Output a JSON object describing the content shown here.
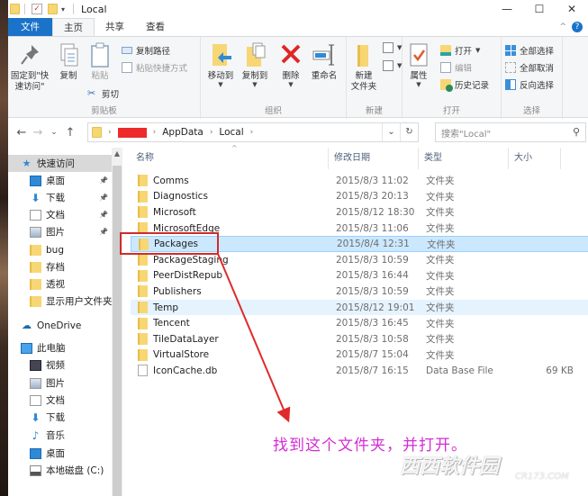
{
  "window": {
    "title": "Local",
    "controls": {
      "minimize": "—",
      "maximize": "☐",
      "close": "✕"
    }
  },
  "quick_access_toolbar": {
    "dropdown": "▾"
  },
  "tabs": [
    {
      "label": "文件",
      "type": "file"
    },
    {
      "label": "主页",
      "active": true
    },
    {
      "label": "共享"
    },
    {
      "label": "查看"
    }
  ],
  "ribbon": {
    "collapse": "^",
    "help": "?",
    "groups": {
      "clipboard": {
        "label": "剪贴板",
        "pin": "固定到\"快\n速访问\"",
        "copy": "复制",
        "paste": "粘贴",
        "copy_path": "复制路径",
        "paste_shortcut": "粘贴快捷方式",
        "cut": "剪切"
      },
      "organize": {
        "label": "组织",
        "move_to": "移动到",
        "copy_to": "复制到",
        "delete": "删除",
        "rename": "重命名"
      },
      "new": {
        "label": "新建",
        "new_folder": "新建\n文件夹"
      },
      "open": {
        "label": "打开",
        "properties": "属性",
        "open": "打开",
        "edit": "编辑",
        "history": "历史记录"
      },
      "select": {
        "label": "选择",
        "select_all": "全部选择",
        "select_none": "全部取消",
        "invert": "反向选择"
      }
    }
  },
  "navigation": {
    "back": "←",
    "forward": "→",
    "recent": "⌄",
    "up": "↑",
    "breadcrumb": [
      "AppData",
      "Local"
    ],
    "redacted_color": "#ee2b2b",
    "dropdown": "⌄",
    "refresh": "↻",
    "search_placeholder": "搜索\"Local\"",
    "search_icon": "⚲"
  },
  "sidebar": {
    "items": [
      {
        "label": "快速访问",
        "icon": "star-icon",
        "selected": true
      },
      {
        "label": "桌面",
        "icon": "desktop-icon",
        "pinned": true
      },
      {
        "label": "下载",
        "icon": "download-icon",
        "pinned": true
      },
      {
        "label": "文档",
        "icon": "document-icon",
        "pinned": true
      },
      {
        "label": "图片",
        "icon": "pictures-icon",
        "pinned": true
      },
      {
        "label": "bug",
        "icon": "folder-icon"
      },
      {
        "label": "存档",
        "icon": "folder-icon"
      },
      {
        "label": "透视",
        "icon": "folder-icon"
      },
      {
        "label": "显示用户文件夹",
        "icon": "folder-icon"
      },
      {
        "label": "OneDrive",
        "icon": "cloud-icon"
      },
      {
        "label": "此电脑",
        "icon": "computer-icon"
      },
      {
        "label": "视频",
        "icon": "video-icon"
      },
      {
        "label": "图片",
        "icon": "pictures-icon"
      },
      {
        "label": "文档",
        "icon": "document-icon"
      },
      {
        "label": "下载",
        "icon": "download-icon"
      },
      {
        "label": "音乐",
        "icon": "music-icon"
      },
      {
        "label": "桌面",
        "icon": "desktop-icon"
      },
      {
        "label": "本地磁盘 (C:)",
        "icon": "drive-icon"
      }
    ]
  },
  "file_list": {
    "columns": [
      "名称",
      "修改日期",
      "类型",
      "大小"
    ],
    "rows": [
      {
        "name": "Comms",
        "date": "2015/8/3 11:02",
        "type": "文件夹",
        "size": ""
      },
      {
        "name": "Diagnostics",
        "date": "2015/8/3 20:13",
        "type": "文件夹",
        "size": ""
      },
      {
        "name": "Microsoft",
        "date": "2015/8/12 18:30",
        "type": "文件夹",
        "size": ""
      },
      {
        "name": "MicrosoftEdge",
        "date": "2015/8/3 11:06",
        "type": "文件夹",
        "size": ""
      },
      {
        "name": "Packages",
        "date": "2015/8/4 12:31",
        "type": "文件夹",
        "size": "",
        "selected": true
      },
      {
        "name": "PackageStaging",
        "date": "2015/8/3 10:59",
        "type": "文件夹",
        "size": ""
      },
      {
        "name": "PeerDistRepub",
        "date": "2015/8/3 16:44",
        "type": "文件夹",
        "size": ""
      },
      {
        "name": "Publishers",
        "date": "2015/8/3 10:59",
        "type": "文件夹",
        "size": ""
      },
      {
        "name": "Temp",
        "date": "2015/8/12 19:01",
        "type": "文件夹",
        "size": "",
        "hover": true
      },
      {
        "name": "Tencent",
        "date": "2015/8/3 16:45",
        "type": "文件夹",
        "size": ""
      },
      {
        "name": "TileDataLayer",
        "date": "2015/8/3 10:58",
        "type": "文件夹",
        "size": ""
      },
      {
        "name": "VirtualStore",
        "date": "2015/8/7 15:04",
        "type": "文件夹",
        "size": ""
      },
      {
        "name": "IconCache.db",
        "date": "2015/8/7 16:15",
        "type": "Data Base File",
        "size": "69 KB",
        "file": true
      }
    ]
  },
  "annotation": {
    "text": "找到这个文件夹，并打开。",
    "color": "#d52cd5",
    "arrow_color": "#e02a2a"
  },
  "watermark": {
    "text": "西西软件园",
    "sub": "CR173.COM"
  }
}
